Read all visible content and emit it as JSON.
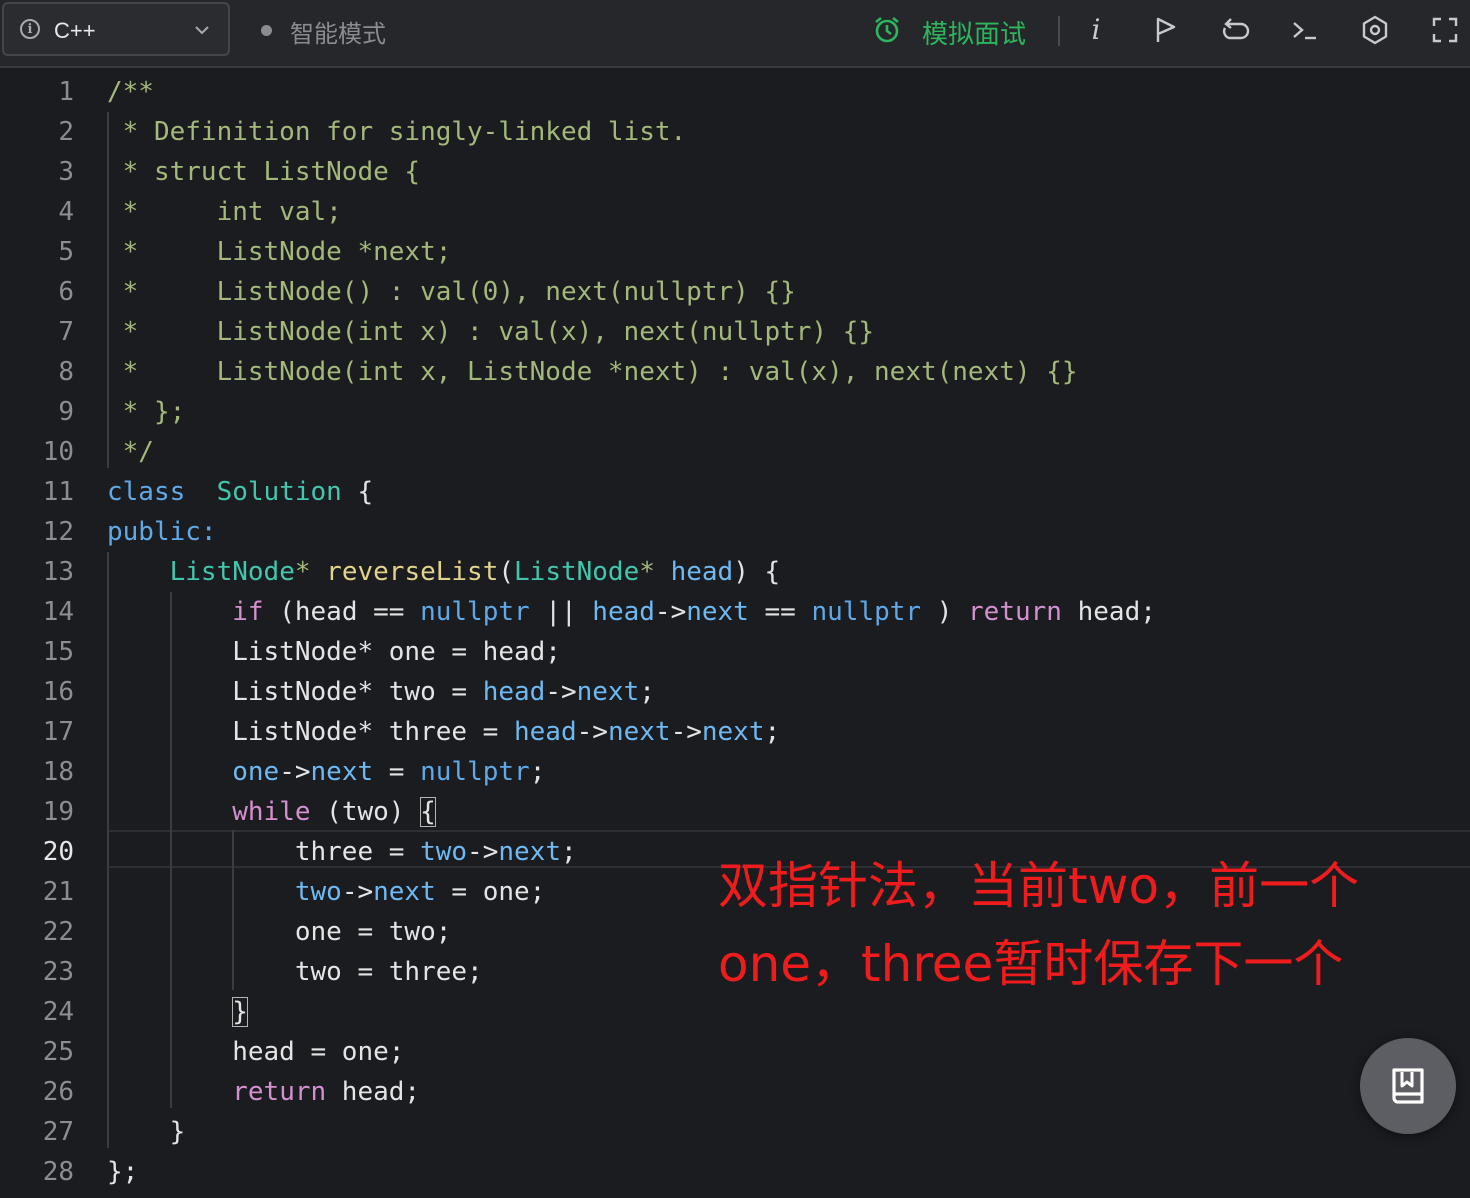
{
  "toolbar": {
    "language": "C++",
    "mode_label": "智能模式",
    "mock_interview_label": "模拟面试",
    "info_glyph": "i",
    "icons": [
      "info-icon",
      "chevron-down-icon",
      "alarm-clock-icon",
      "italic-info-icon",
      "flag-icon",
      "undo-icon",
      "terminal-icon",
      "settings-icon",
      "fullscreen-icon"
    ]
  },
  "editor": {
    "active_line": 20,
    "line_numbers": [
      "1",
      "2",
      "3",
      "4",
      "5",
      "6",
      "7",
      "8",
      "9",
      "10",
      "11",
      "12",
      "13",
      "14",
      "15",
      "16",
      "17",
      "18",
      "19",
      "20",
      "21",
      "22",
      "23",
      "24",
      "25",
      "26",
      "27",
      "28"
    ],
    "lines": [
      [
        [
          "c",
          "/**"
        ]
      ],
      [
        [
          "c",
          " * Definition for singly-linked list."
        ]
      ],
      [
        [
          "c",
          " * struct ListNode {"
        ]
      ],
      [
        [
          "c",
          " *     int val;"
        ]
      ],
      [
        [
          "c",
          " *     ListNode *next;"
        ]
      ],
      [
        [
          "c",
          " *     ListNode() : val(0), next(nullptr) {}"
        ]
      ],
      [
        [
          "c",
          " *     ListNode(int x) : val(x), next(nullptr) {}"
        ]
      ],
      [
        [
          "c",
          " *     ListNode(int x, ListNode *next) : val(x), next(next) {}"
        ]
      ],
      [
        [
          "c",
          " * };"
        ]
      ],
      [
        [
          "c",
          " */"
        ]
      ],
      [
        [
          "k",
          "class"
        ],
        [
          "",
          "  "
        ],
        [
          "t",
          "Solution"
        ],
        [
          "",
          " {"
        ]
      ],
      [
        [
          "k",
          "public:"
        ]
      ],
      [
        [
          "",
          "    "
        ],
        [
          "t",
          "ListNode"
        ],
        [
          "c",
          "*"
        ],
        [
          "",
          " "
        ],
        [
          "f",
          "reverseList"
        ],
        [
          "",
          "("
        ],
        [
          "t",
          "ListNode"
        ],
        [
          "c",
          "*"
        ],
        [
          "",
          " "
        ],
        [
          "p",
          "head"
        ],
        [
          "",
          ") {"
        ]
      ],
      [
        [
          "",
          "        "
        ],
        [
          "r",
          "if"
        ],
        [
          "",
          " (head == "
        ],
        [
          "k",
          "nullptr"
        ],
        [
          "",
          " || "
        ],
        [
          "p",
          "head"
        ],
        [
          "",
          "->"
        ],
        [
          "m",
          "next"
        ],
        [
          "",
          " == "
        ],
        [
          "k",
          "nullptr"
        ],
        [
          "",
          " ) "
        ],
        [
          "r",
          "return"
        ],
        [
          "",
          " head;"
        ]
      ],
      [
        [
          "",
          "        ListNode* one = head;"
        ]
      ],
      [
        [
          "",
          "        ListNode* two = "
        ],
        [
          "p",
          "head"
        ],
        [
          "",
          "->"
        ],
        [
          "m",
          "next"
        ],
        [
          "",
          ";"
        ]
      ],
      [
        [
          "",
          "        ListNode* three = "
        ],
        [
          "p",
          "head"
        ],
        [
          "",
          "->"
        ],
        [
          "m",
          "next"
        ],
        [
          "",
          "->"
        ],
        [
          "m",
          "next"
        ],
        [
          "",
          ";"
        ]
      ],
      [
        [
          "",
          "        "
        ],
        [
          "p",
          "one"
        ],
        [
          "",
          "->"
        ],
        [
          "m",
          "next"
        ],
        [
          "",
          " = "
        ],
        [
          "k",
          "nullptr"
        ],
        [
          "",
          ";"
        ]
      ],
      [
        [
          "",
          "        "
        ],
        [
          "r",
          "while"
        ],
        [
          "",
          " (two) "
        ],
        [
          "br",
          "{"
        ]
      ],
      [
        [
          "",
          "            three = "
        ],
        [
          "p",
          "two"
        ],
        [
          "",
          "->"
        ],
        [
          "m",
          "next"
        ],
        [
          "",
          ";"
        ]
      ],
      [
        [
          "",
          "            "
        ],
        [
          "p",
          "two"
        ],
        [
          "",
          "->"
        ],
        [
          "m",
          "next"
        ],
        [
          "",
          " = one;"
        ]
      ],
      [
        [
          "",
          "            one = two;"
        ]
      ],
      [
        [
          "",
          "            two = three;"
        ]
      ],
      [
        [
          "",
          "        "
        ],
        [
          "br",
          "}"
        ]
      ],
      [
        [
          "",
          "        head = one;"
        ]
      ],
      [
        [
          "",
          "        "
        ],
        [
          "r",
          "return"
        ],
        [
          "",
          " head;"
        ]
      ],
      [
        [
          "",
          "    }"
        ]
      ],
      [
        [
          "",
          "};"
        ]
      ]
    ]
  },
  "annotation": {
    "line1": "双指针法，当前two，前一个",
    "line2": "one，three暂时保存下一个",
    "color": "#ee1c1c"
  },
  "fab": {
    "icon": "notebook-icon"
  }
}
